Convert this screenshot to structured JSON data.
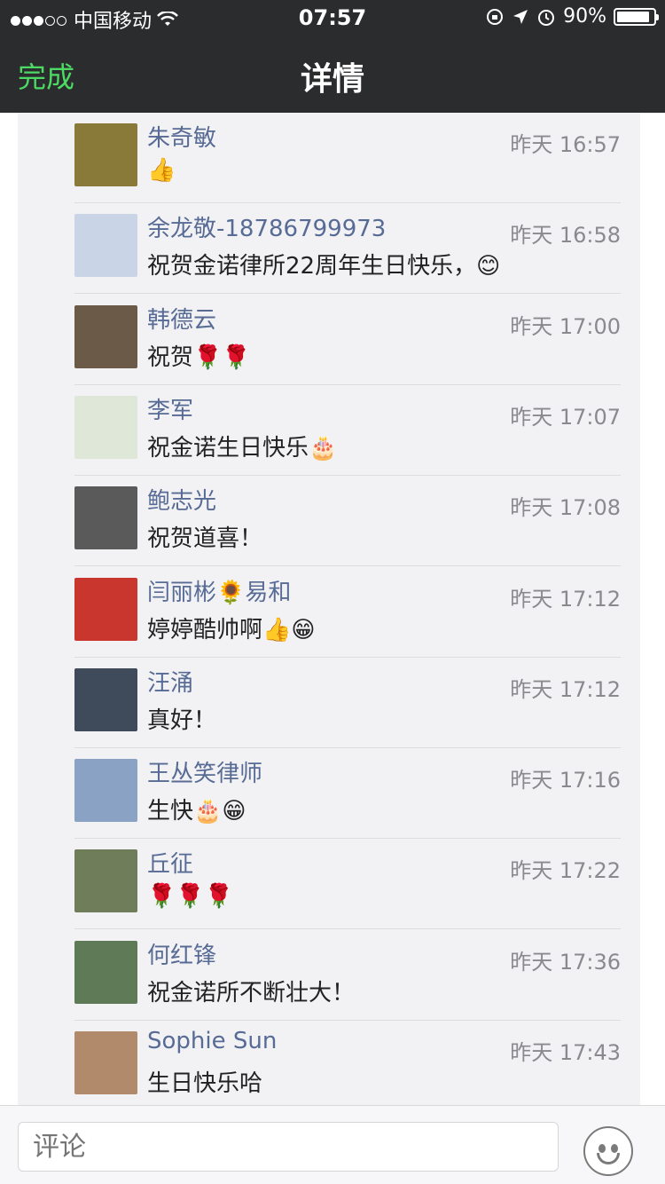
{
  "status_bar": {
    "carrier": "中国移动",
    "time": "07:57",
    "battery": "90%",
    "battery_level": 0.9,
    "icons": [
      "signal-dots-icon",
      "wifi-icon",
      "rotation-lock-icon",
      "location-arrow-icon",
      "alarm-icon",
      "battery-icon"
    ]
  },
  "nav": {
    "done_label": "完成",
    "title": "详情"
  },
  "comments": [
    {
      "name": "朱奇敏",
      "time": "昨天 16:57",
      "text": "👍"
    },
    {
      "name": "余龙敬-18786799973",
      "time": "昨天 16:58",
      "text": "祝贺金诺律所22周年生日快乐，😊"
    },
    {
      "name": "韩德云",
      "time": "昨天 17:00",
      "text": "祝贺🌹🌹"
    },
    {
      "name": "李军",
      "time": "昨天 17:07",
      "text": "祝金诺生日快乐🎂"
    },
    {
      "name": "鲍志光",
      "time": "昨天 17:08",
      "text": "祝贺道喜！"
    },
    {
      "name": "闫丽彬🌻易和",
      "time": "昨天 17:12",
      "text": "婷婷酷帅啊👍😁"
    },
    {
      "name": "汪涌",
      "time": "昨天 17:12",
      "text": "真好！"
    },
    {
      "name": "王丛笑律师",
      "time": "昨天 17:16",
      "text": "生快🎂😁"
    },
    {
      "name": "丘征",
      "time": "昨天 17:22",
      "text": "🌹🌹🌹"
    },
    {
      "name": "何红锋",
      "time": "昨天 17:36",
      "text": "祝金诺所不断壮大！"
    },
    {
      "name": "Sophie Sun",
      "time": "昨天 17:43",
      "text": "生日快乐哈"
    }
  ],
  "avatar_colors": [
    "#8a7a3a",
    "#c9d4e6",
    "#6b5a48",
    "#dfe8d8",
    "#5a5a5a",
    "#c8362e",
    "#3f4a5a",
    "#8aa2c4",
    "#6f7d5a",
    "#5f7a56",
    "#b08a6a"
  ],
  "footer": {
    "comment_placeholder": "评论",
    "emoji_button_icon": "emoji-face-icon"
  },
  "colors": {
    "nav_bg": "#2b2c2e",
    "done": "#4cd964",
    "name": "#576b95",
    "list_bg": "#f2f2f5"
  }
}
